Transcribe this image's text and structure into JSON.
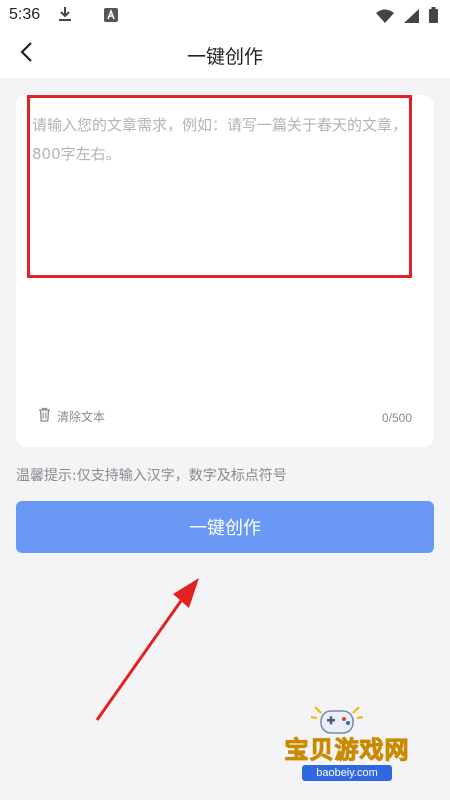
{
  "status_bar": {
    "time": "5:36",
    "left_icons": [
      "download-icon",
      "app-a-icon"
    ],
    "right_icons": [
      "wifi-icon",
      "signal-icon",
      "battery-icon"
    ]
  },
  "header": {
    "title": "一键创作",
    "back_icon": "chevron-left-icon"
  },
  "editor": {
    "value": "",
    "placeholder": "请输入您的文章需求，例如：请写一篇关于春天的文章，800字左右。",
    "highlight_color": "#e22222",
    "clear_label": "清除文本",
    "clear_icon": "trash-icon",
    "counter": "0/500"
  },
  "tip": "温馨提示:仅支持输入汉字，数字及标点符号",
  "create_button": {
    "label": "一键创作",
    "color": "#6a99f5"
  },
  "annotation_arrow": {
    "color": "#e22222"
  },
  "watermark": {
    "title": "宝贝游戏网",
    "url": "baobeiy.com"
  }
}
